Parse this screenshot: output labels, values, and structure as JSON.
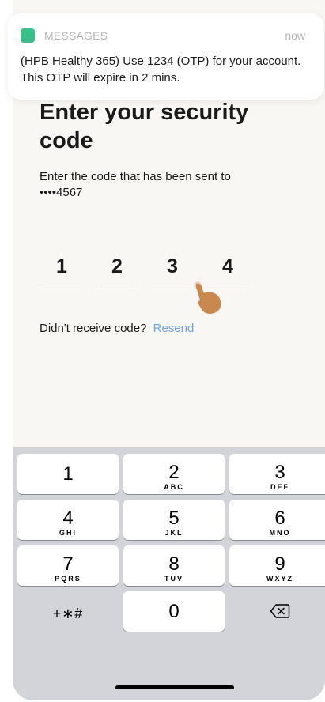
{
  "notification": {
    "app_name": "MESSAGES",
    "time": "now",
    "message": "(HPB Healthy 365) Use 1234 (OTP) for your account.  This OTP will expire in 2 mins."
  },
  "page": {
    "title": "Enter your security code",
    "subtitle": "Enter the code that has been sent to",
    "masked_number": "••••4567"
  },
  "otp": {
    "digits": [
      "1",
      "2",
      "3",
      "4"
    ]
  },
  "resend": {
    "prompt": "Didn't receive code?",
    "link": "Resend"
  },
  "keypad": {
    "keys": [
      {
        "num": "1",
        "letters": ""
      },
      {
        "num": "2",
        "letters": "ABC"
      },
      {
        "num": "3",
        "letters": "DEF"
      },
      {
        "num": "4",
        "letters": "GHI"
      },
      {
        "num": "5",
        "letters": "JKL"
      },
      {
        "num": "6",
        "letters": "MNO"
      },
      {
        "num": "7",
        "letters": "PQRS"
      },
      {
        "num": "8",
        "letters": "TUV"
      },
      {
        "num": "9",
        "letters": "WXYZ"
      },
      {
        "num": "+∗#",
        "letters": ""
      },
      {
        "num": "0",
        "letters": ""
      },
      {
        "num": "",
        "letters": ""
      }
    ]
  },
  "colors": {
    "accent_link": "#6ca6e6",
    "app_icon": "#3bbf8a"
  },
  "icons": {
    "backspace": "backspace-icon",
    "hand": "pointing-hand-icon"
  }
}
